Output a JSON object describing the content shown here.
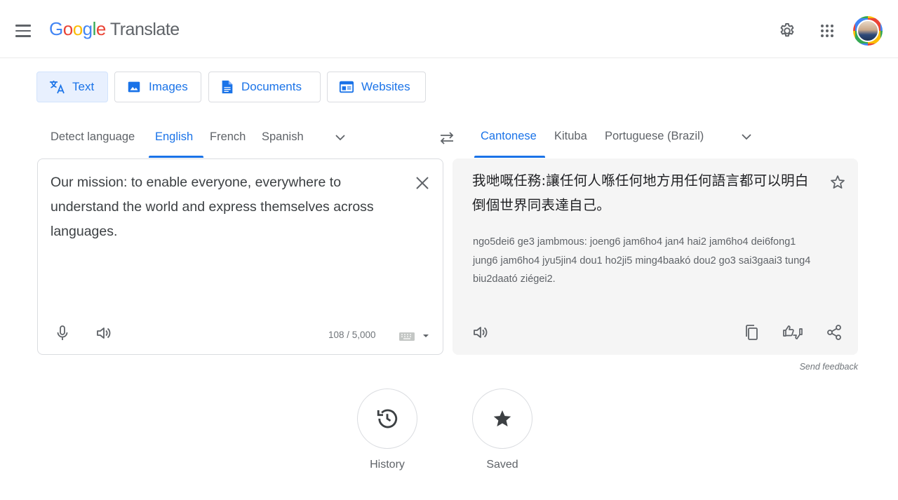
{
  "header": {
    "logo_letters": [
      "G",
      "o",
      "o",
      "g",
      "l",
      "e"
    ],
    "product_name": "Translate",
    "icons": [
      "menu-icon",
      "settings-icon",
      "apps-grid-icon",
      "account-avatar"
    ]
  },
  "mode_tabs": [
    {
      "label": "Text",
      "icon": "translate-icon",
      "active": true
    },
    {
      "label": "Images",
      "icon": "image-icon",
      "active": false
    },
    {
      "label": "Documents",
      "icon": "document-icon",
      "active": false
    },
    {
      "label": "Websites",
      "icon": "web-icon",
      "active": false
    }
  ],
  "source_langs": {
    "items": [
      "Detect language",
      "English",
      "French",
      "Spanish"
    ],
    "selected": "English"
  },
  "target_langs": {
    "items": [
      "Cantonese",
      "Kituba",
      "Portuguese (Brazil)"
    ],
    "selected": "Cantonese"
  },
  "source": {
    "text": "Our mission: to enable everyone, everywhere to understand the world and express themselves across languages.",
    "char_count": "108 / 5,000"
  },
  "target": {
    "text": "我哋嘅任務:讓任何人喺任何地方用任何語言都可以明白倒個世界同表達自己。",
    "romanization": "ngo5dei6 ge3 jambmous: joeng6 jam6ho4 jan4 hai2 jam6ho4 dei6fong1 jung6 jam6ho4 jyu5jin4 dou1 ho2ji5 ming4baakó dou2 go3 sai3gaai3 tung4 biu2daató ziégei2."
  },
  "feedback_label": "Send feedback",
  "shortcuts": [
    {
      "label": "History",
      "icon": "history-icon"
    },
    {
      "label": "Saved",
      "icon": "star-icon"
    }
  ],
  "colors": {
    "accent": "#1a73e8",
    "active_tab_bg": "#e8f0fe",
    "text_gray": "#5f6368",
    "target_panel_bg": "#f5f5f5"
  }
}
